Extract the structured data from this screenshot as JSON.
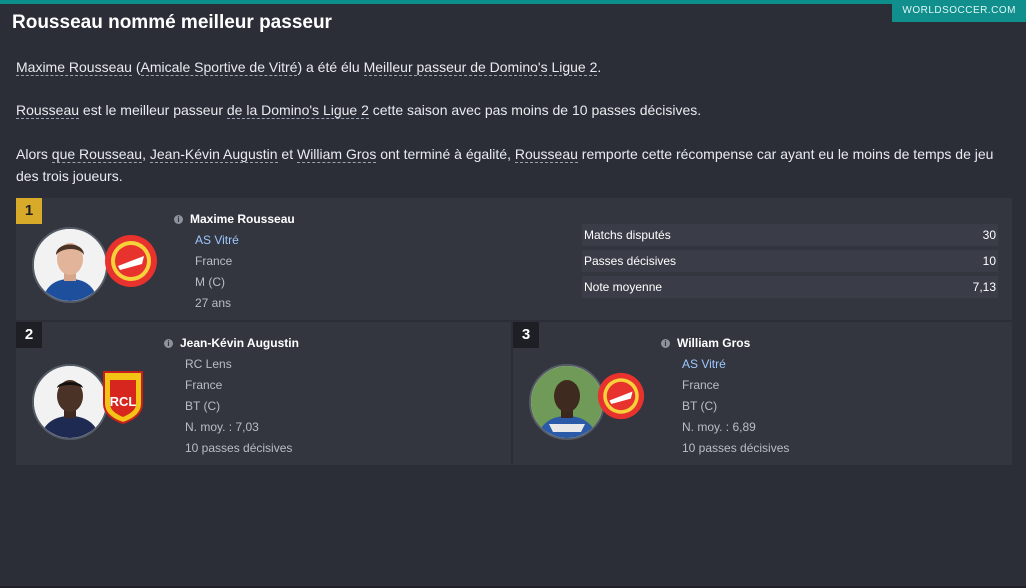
{
  "brand": "WORLDSOCCER.COM",
  "title": "Rousseau nommé meilleur passeur",
  "para1": {
    "a": "Maxime Rousseau",
    "b": " (",
    "c": "Amicale Sportive de Vitré",
    "d": ") a été élu ",
    "e": "Meilleur passeur de Domino's Ligue 2",
    "f": "."
  },
  "para2": {
    "a": "Rousseau",
    "b": " est le meilleur passeur ",
    "c": "de la Domino's Ligue 2",
    "d": " cette saison avec pas moins de 10 passes décisives."
  },
  "para3": {
    "a": "Alors ",
    "b": "que Rousseau",
    "c": ", ",
    "d": "Jean-Kévin Augustin",
    "e": " et ",
    "f": "William Gros",
    "g": " ont terminé à égalité, ",
    "h": "Rousseau",
    "i": " remporte cette récompense car ayant eu le moins de temps de jeu des trois joueurs."
  },
  "first": {
    "rank": "1",
    "name": "Maxime Rousseau",
    "club": "AS Vitré",
    "nation": "France",
    "position": "M (C)",
    "age": "27 ans",
    "stats": [
      {
        "label": "Matchs disputés",
        "value": "30"
      },
      {
        "label": "Passes décisives",
        "value": "10"
      },
      {
        "label": "Note moyenne",
        "value": "7,13"
      }
    ]
  },
  "second": {
    "rank": "2",
    "name": "Jean-Kévin Augustin",
    "club": "RC Lens",
    "nation": "France",
    "position": "BT (C)",
    "rating": "N. moy. : 7,03",
    "assists": "10 passes décisives"
  },
  "third": {
    "rank": "3",
    "name": "William Gros",
    "club": "AS Vitré",
    "nation": "France",
    "position": "BT (C)",
    "rating": "N. moy. : 6,89",
    "assists": "10 passes décisives"
  },
  "colors": {
    "accent": "#118f8c",
    "gold": "#d7aa2a",
    "background": "#2b2e37",
    "panel": "#33363f"
  }
}
